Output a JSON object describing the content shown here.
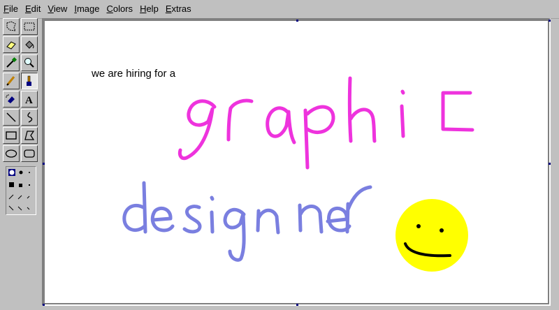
{
  "menu": [
    {
      "label": "File",
      "key": "F",
      "rest": "ile"
    },
    {
      "label": "Edit",
      "key": "E",
      "rest": "dit"
    },
    {
      "label": "View",
      "key": "V",
      "rest": "iew"
    },
    {
      "label": "Image",
      "key": "I",
      "rest": "mage"
    },
    {
      "label": "Colors",
      "key": "C",
      "rest": "olors"
    },
    {
      "label": "Help",
      "key": "H",
      "rest": "elp"
    },
    {
      "label": "Extras",
      "key": "E",
      "rest": "xtras"
    }
  ],
  "tools": [
    "free-form-select",
    "rectangle-select",
    "eraser",
    "fill-with-color",
    "pick-color",
    "magnifier",
    "pencil",
    "brush",
    "airbrush",
    "text",
    "line",
    "curve",
    "rectangle",
    "polygon",
    "ellipse",
    "rounded-rectangle"
  ],
  "active_tool": "brush",
  "canvas": {
    "caption": "we are hiring for a",
    "word1": "graphic",
    "word2": "designer",
    "colors": {
      "word1": "#ee33dd",
      "word2": "#7a7fe0",
      "smiley": "#ffff00",
      "ink": "#000000"
    }
  }
}
